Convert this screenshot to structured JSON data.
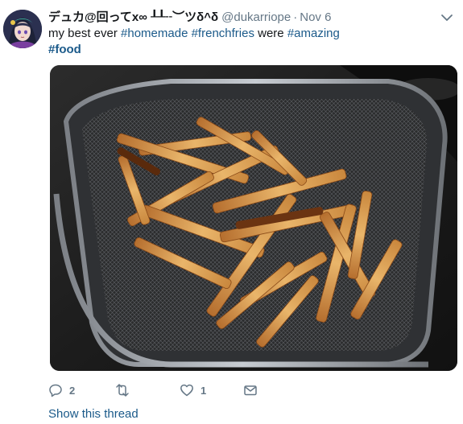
{
  "tweet": {
    "display_name": "デュカ@回ってx∞ ┸┸╌︶ツδ^δ",
    "handle": "@dukarriope",
    "separator": "·",
    "time": "Nov 6",
    "text_prefix": "my best ever ",
    "hashtag_1": "#homemade",
    "space_1": " ",
    "hashtag_2": "#frenchfries",
    "text_middle": " were ",
    "hashtag_3": "#amazing",
    "hashtag_4": "#food",
    "media_description_icon": "photo-french-fries-in-fryer-basket"
  },
  "actions": {
    "reply_count": "2",
    "retweet_count": "",
    "like_count": "1"
  },
  "show_thread_label": "Show this thread",
  "colors": {
    "link": "#1b5a8a",
    "muted": "#657786",
    "text": "#14171a"
  }
}
